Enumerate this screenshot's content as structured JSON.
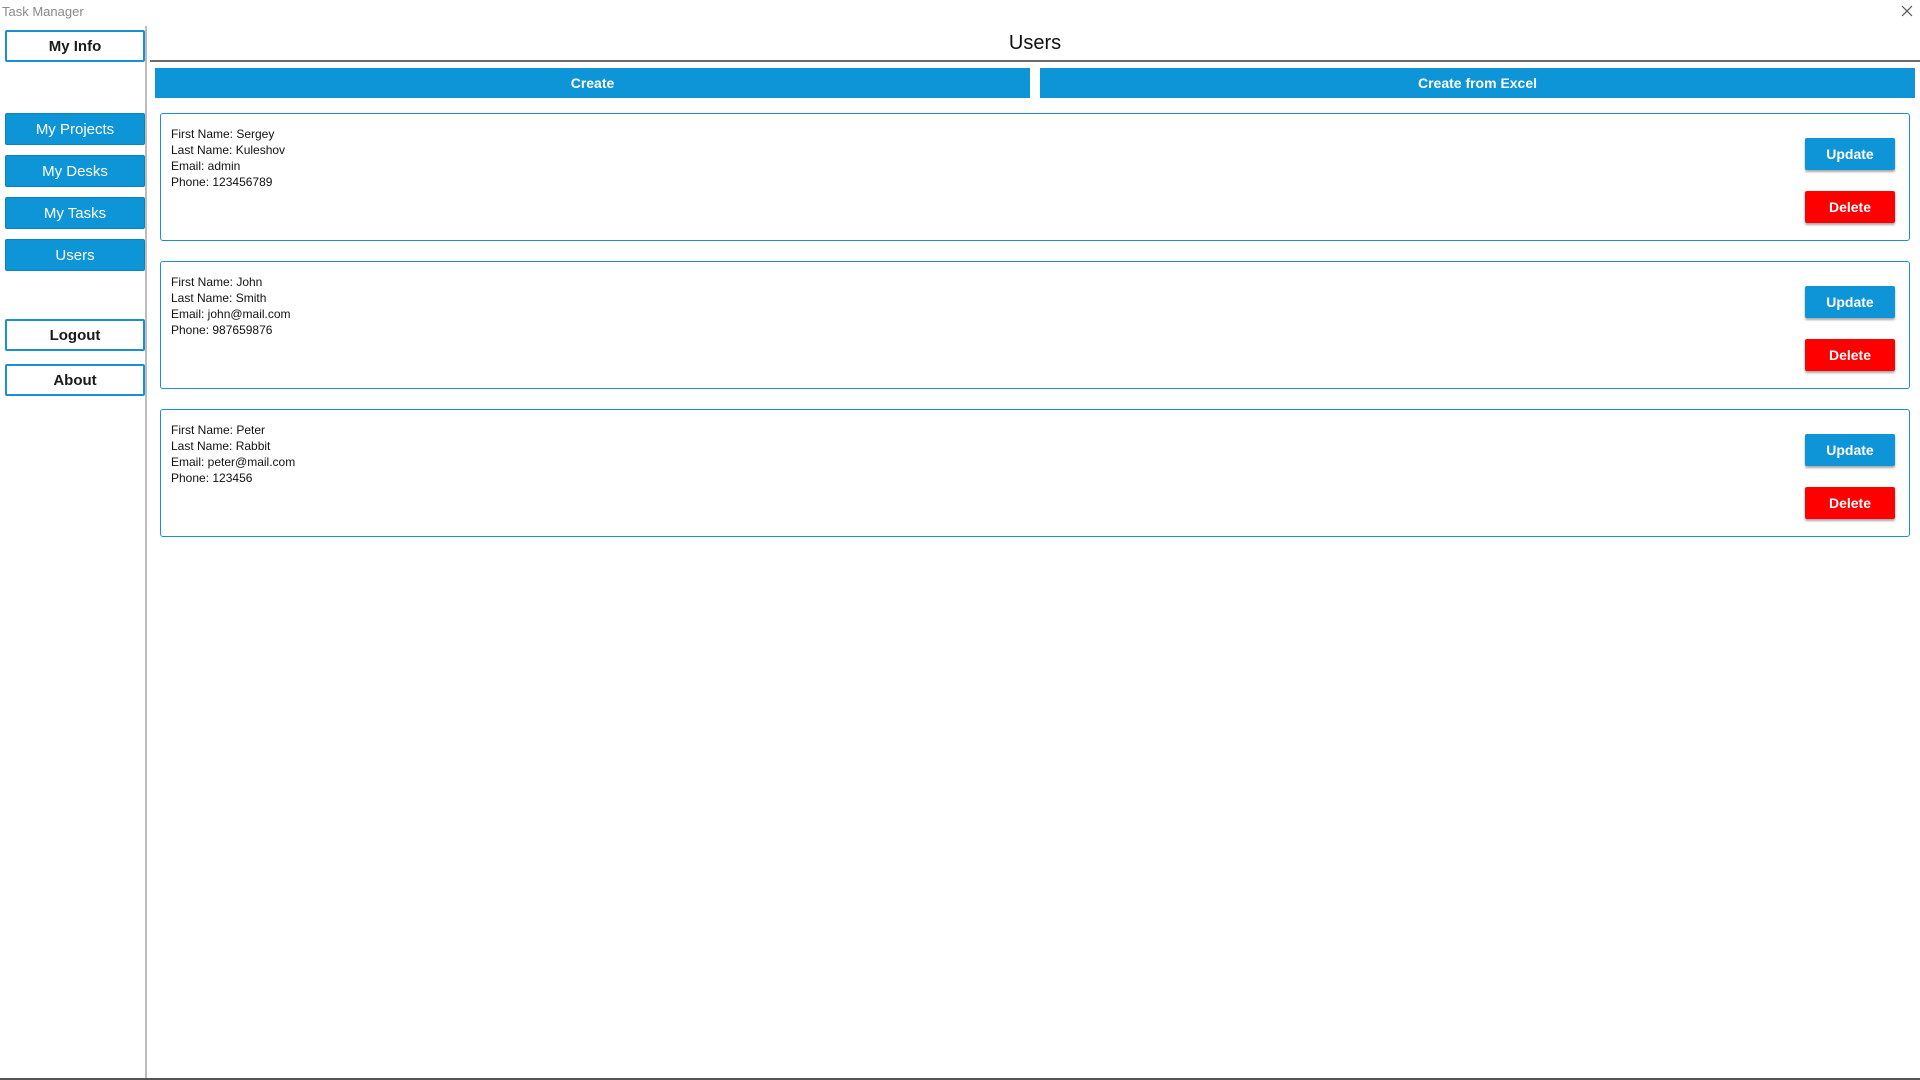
{
  "window": {
    "title": "Task Manager"
  },
  "sidebar": {
    "my_info": "My Info",
    "items": [
      {
        "id": "projects",
        "label": "My Projects"
      },
      {
        "id": "desks",
        "label": "My Desks"
      },
      {
        "id": "tasks",
        "label": "My Tasks"
      },
      {
        "id": "users",
        "label": "Users"
      }
    ],
    "logout": "Logout",
    "about": "About"
  },
  "main": {
    "title": "Users",
    "create_label": "Create",
    "create_excel_label": "Create from Excel",
    "update_label": "Update",
    "delete_label": "Delete",
    "users": [
      {
        "first": "First Name: Sergey",
        "last": "Last Name: Kuleshov",
        "email": "Email: admin",
        "phone": "Phone: 123456789"
      },
      {
        "first": "First Name: John",
        "last": "Last Name: Smith",
        "email": "Email: john@mail.com",
        "phone": "Phone: 987659876"
      },
      {
        "first": "First Name: Peter",
        "last": "Last Name: Rabbit",
        "email": "Email: peter@mail.com",
        "phone": "Phone: 123456"
      }
    ]
  },
  "colors": {
    "accent": "#0e95d7",
    "danger": "#ff0000",
    "border": "#1a8fd3"
  }
}
